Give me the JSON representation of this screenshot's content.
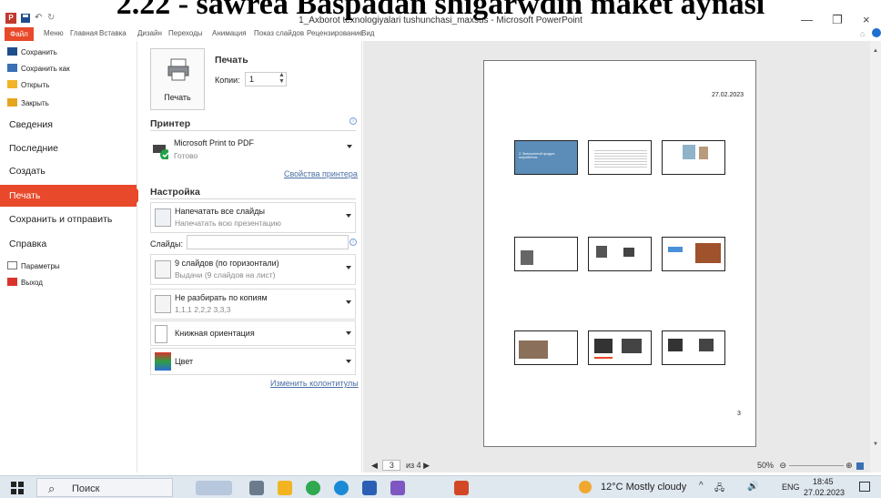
{
  "overlay_heading": "2.22 - sawrea Baspadan shigarwdin maket aynasi",
  "window": {
    "title": "1_Axborot texnologiyalari tushunchasi_maxsus - Microsoft PowerPoint",
    "minimize": "—",
    "restore": "❐",
    "close": "×"
  },
  "ribbon_tabs": [
    {
      "label": "Файл"
    },
    {
      "label": "Меню"
    },
    {
      "label": "Главная"
    },
    {
      "label": "Вставка"
    },
    {
      "label": "Дизайн"
    },
    {
      "label": "Переходы"
    },
    {
      "label": "Анимация"
    },
    {
      "label": "Показ слайдов"
    },
    {
      "label": "Рецензирование"
    },
    {
      "label": "Вид"
    }
  ],
  "backstage": {
    "small_items": [
      {
        "label": "Сохранить",
        "icon": "save-icon"
      },
      {
        "label": "Сохранить как",
        "icon": "save-as-icon"
      },
      {
        "label": "Открыть",
        "icon": "open-folder-icon"
      },
      {
        "label": "Закрыть",
        "icon": "close-folder-icon"
      }
    ],
    "big_items": [
      {
        "label": "Сведения"
      },
      {
        "label": "Последние"
      },
      {
        "label": "Создать"
      },
      {
        "label": "Печать",
        "active": true
      },
      {
        "label": "Сохранить и отправить"
      },
      {
        "label": "Справка"
      }
    ],
    "bottom_items": [
      {
        "label": "Параметры",
        "icon": "options-icon"
      },
      {
        "label": "Выход",
        "icon": "exit-icon"
      }
    ]
  },
  "print": {
    "heading": "Печать",
    "button_label": "Печать",
    "copies_label": "Копии:",
    "copies_value": "1",
    "printer_heading": "Принтер",
    "printer_name": "Microsoft Print to PDF",
    "printer_status": "Готово",
    "printer_properties_link": "Свойства принтера",
    "settings_heading": "Настройка",
    "slides_range_title": "Напечатать все слайды",
    "slides_range_sub": "Напечатать всю презентацию",
    "slides_label": "Слайды:",
    "slides_value": "",
    "layout_title": "9 слайдов (по горизонтали)",
    "layout_sub": "Выдачи (9 слайдов на лист)",
    "collate_title": "Не разбирать по копиям",
    "collate_sub": "1,1,1   2,2,2   3,3,3",
    "orientation": "Книжная ориентация",
    "color": "Цвет",
    "header_footer_link": "Изменить колонтитулы"
  },
  "preview": {
    "date": "27.02.2023",
    "page_number": "3",
    "slide1_title": "2. Электронный продукт-потребитель",
    "nav_current": "3",
    "nav_total": "из 4",
    "zoom": "50%"
  },
  "taskbar": {
    "search_placeholder": "Поиск",
    "weather": "12°C  Mostly cloudy",
    "lang": "ENG",
    "time": "18:45",
    "date": "27.02.2023"
  },
  "colors": {
    "accent": "#e8492a",
    "slide_blue": "#5b8db8",
    "taskbar": "#dfe7ef"
  }
}
